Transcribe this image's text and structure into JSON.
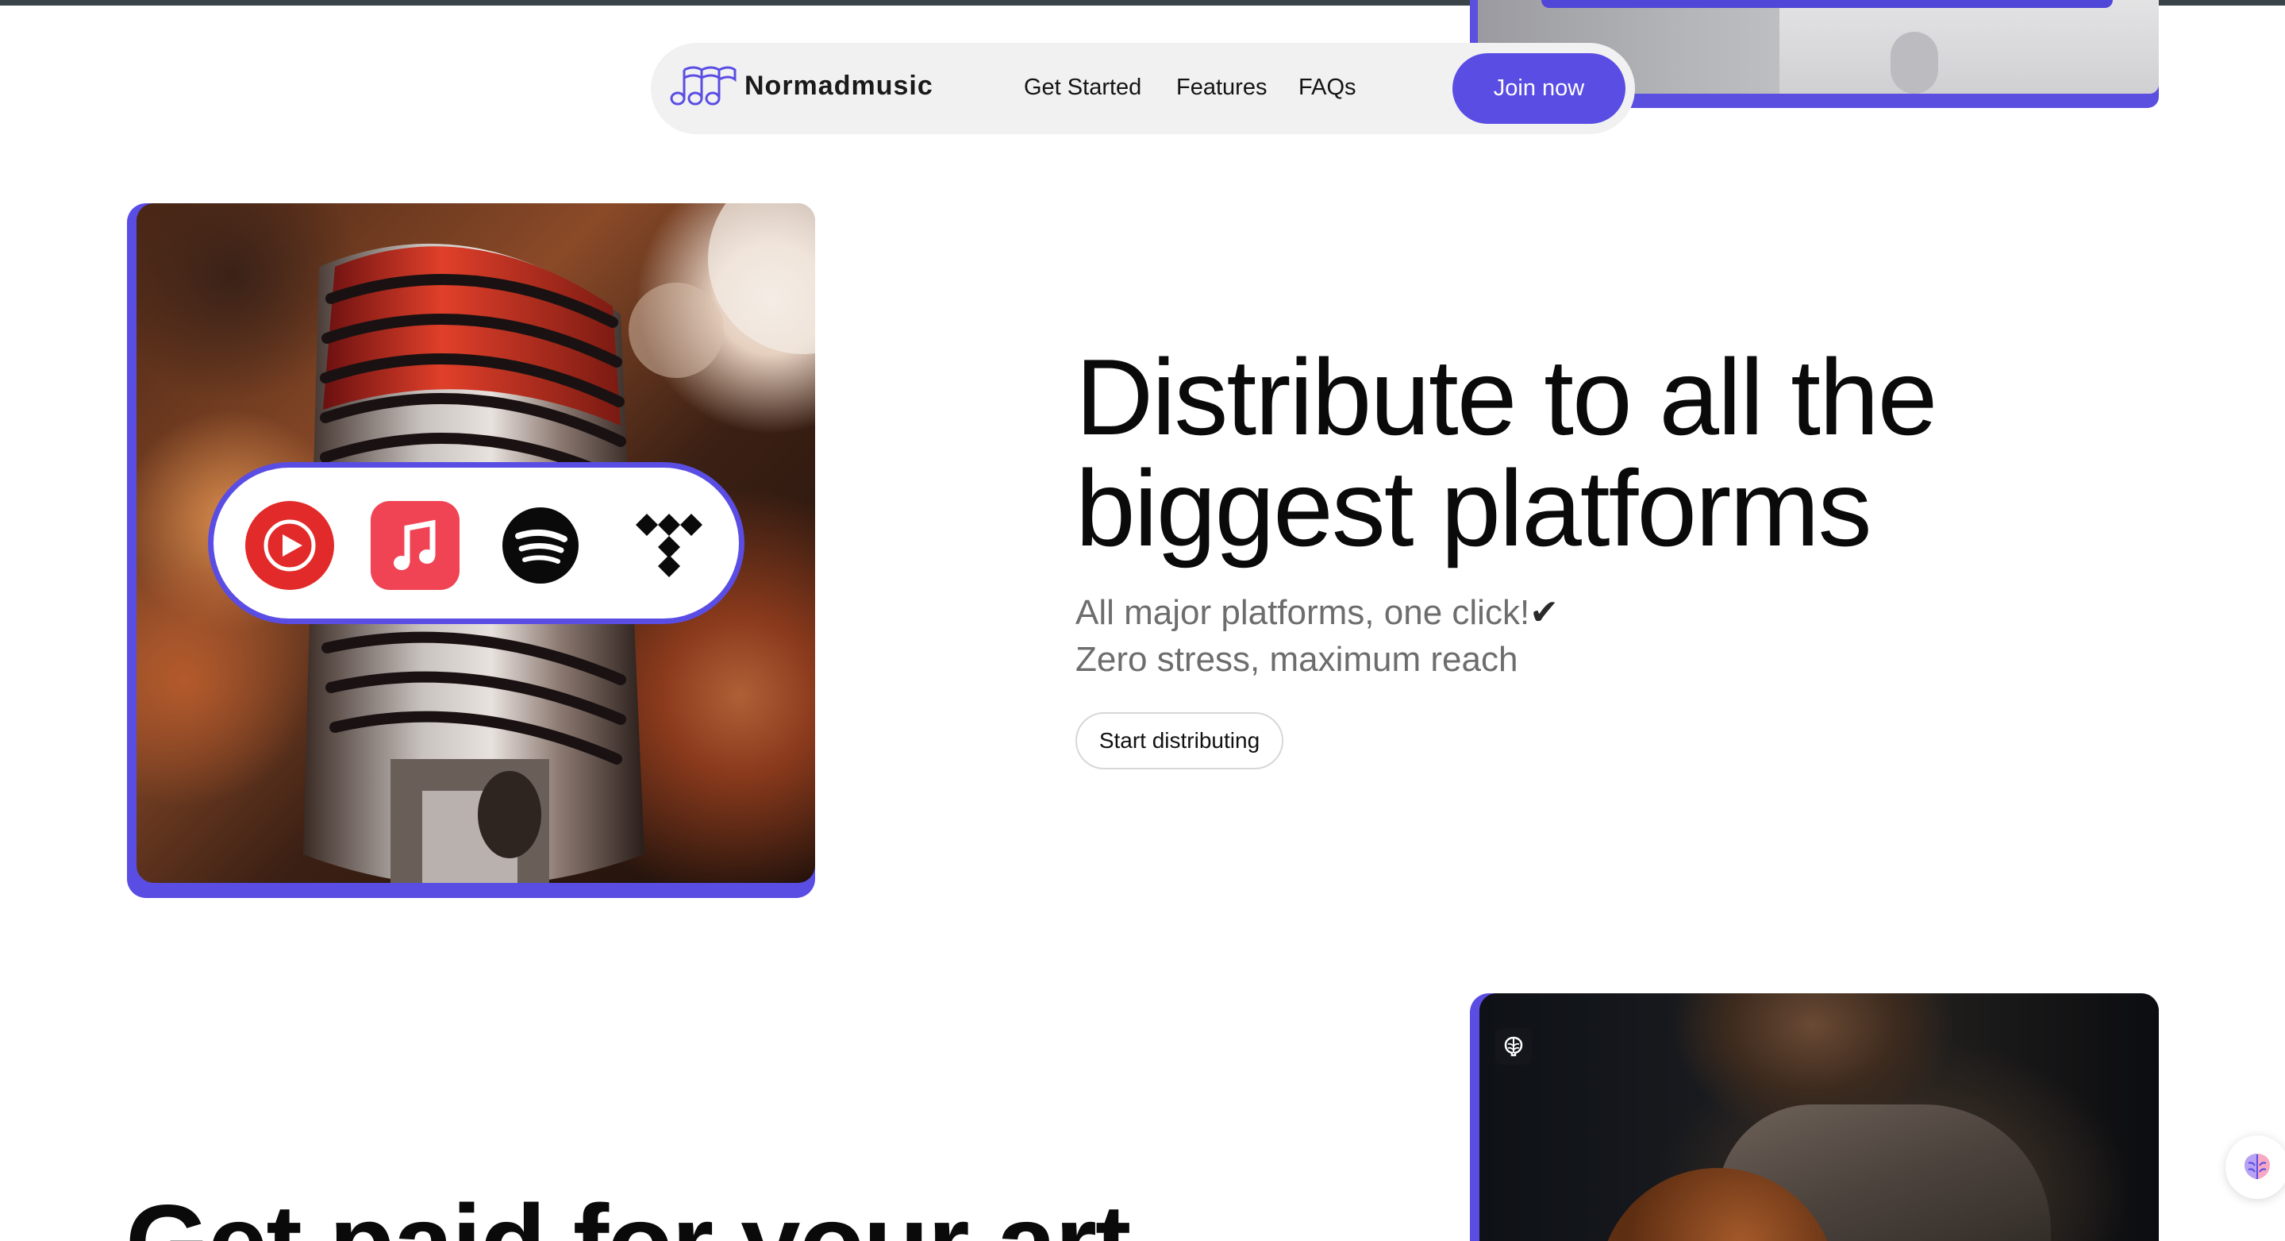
{
  "navbar": {
    "brand": "Normadmusic",
    "links": [
      "Get Started",
      "Features",
      "FAQs"
    ],
    "join_label": "Join now"
  },
  "hero": {
    "title_line1": "Distribute to all the",
    "title_line2": "biggest platforms",
    "subtitle_line1": "All major platforms, one click!",
    "subtitle_check": "✔",
    "subtitle_line2": "Zero stress, maximum reach",
    "cta_label": "Start distributing",
    "platform_icons": [
      "youtube-music-icon",
      "apple-music-icon",
      "spotify-icon",
      "tidal-icon"
    ]
  },
  "next_section": {
    "title": "Get paid for your art"
  },
  "colors": {
    "accent": "#5a4de3",
    "youtube_red": "#e32a2a",
    "apple_pink": "#f04455",
    "text_dark": "#0a0a0a",
    "text_muted": "#6d6d6d",
    "nav_bg": "#f1f1f2"
  }
}
